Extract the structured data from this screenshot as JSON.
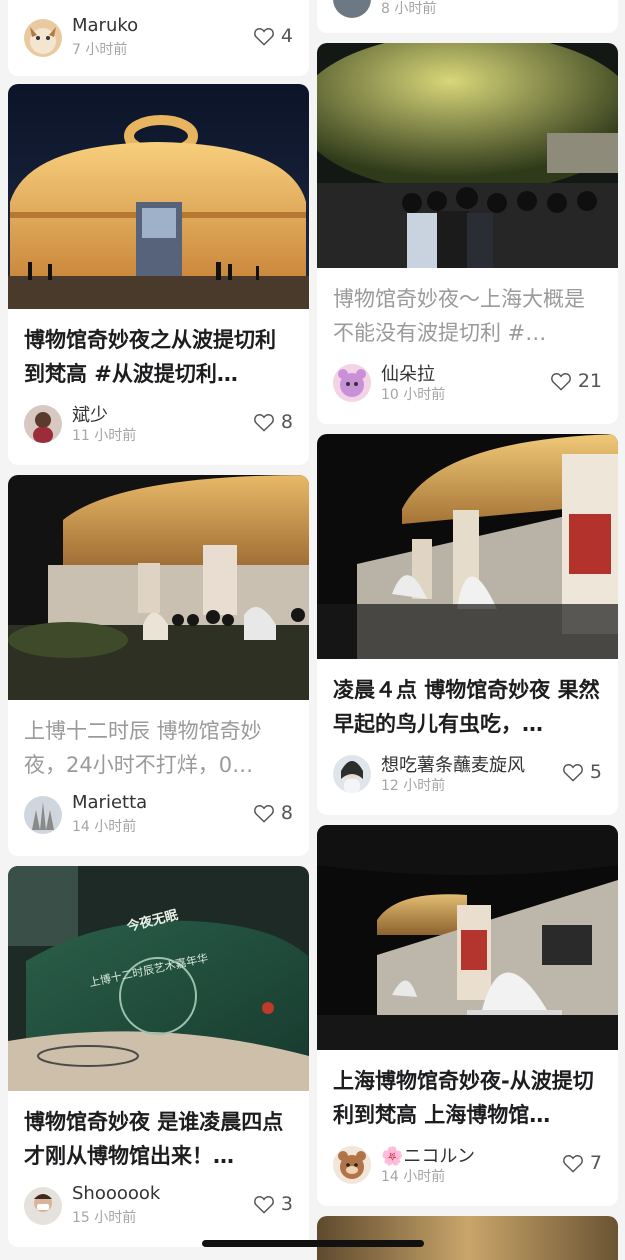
{
  "left_column": [
    {
      "title": "",
      "author": "Maruko",
      "time": "7 小时前",
      "likes": "4"
    },
    {
      "title": "博物馆奇妙夜之从波提切利到梵高 #从波提切利…",
      "author": "斌少",
      "time": "11 小时前",
      "likes": "8"
    },
    {
      "title": "上博十二时辰 博物馆奇妙夜，24小时不打烊，0…",
      "author": "Marietta",
      "time": "14 小时前",
      "likes": "8"
    },
    {
      "title": "博物馆奇妙夜 是谁凌晨四点才刚从博物馆出来！…",
      "author": "Shoooook",
      "time": "15 小时前",
      "likes": "3"
    }
  ],
  "right_column": [
    {
      "title": "",
      "author": "",
      "time": "8 小时前",
      "likes": ""
    },
    {
      "title": "博物馆奇妙夜～上海大概是不能没有波提切利 #…",
      "author": "仙朵拉",
      "time": "10 小时前",
      "likes": "21"
    },
    {
      "title": "凌晨４点 博物馆奇妙夜 果然早起的鸟儿有虫吃，…",
      "author": "想吃薯条蘸麦旋风",
      "time": "12 小时前",
      "likes": "5"
    },
    {
      "title": "上海博物馆奇妙夜-从波提切利到梵高 上海博物馆…",
      "author": "🌸ニコルン",
      "time": "14 小时前",
      "likes": "7"
    }
  ],
  "poster_text": {
    "banner_title": "今夜无眠",
    "banner_subtitle": "上博十二时辰艺术嘉年华"
  },
  "icons": {
    "like": "heart-outline-icon"
  }
}
